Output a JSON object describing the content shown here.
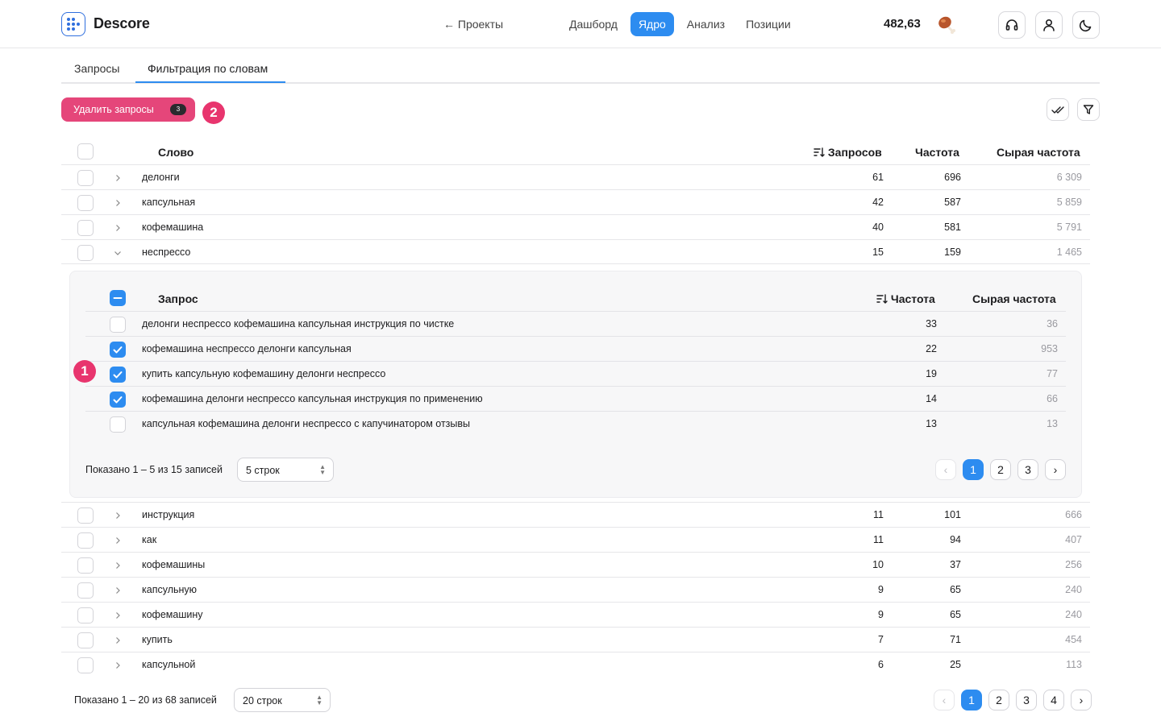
{
  "header": {
    "brand": "Descore",
    "projects_link": "← Проекты",
    "nav": [
      "Дашборд",
      "Ядро",
      "Анализ",
      "Позиции"
    ],
    "active_nav": "Ядро",
    "balance": "482,63"
  },
  "tabs": [
    "Запросы",
    "Фильтрация по словам"
  ],
  "active_tab": "Фильтрация по словам",
  "toolbar": {
    "delete_label": "Удалить запросы",
    "delete_count": "3",
    "marker_2": "2",
    "marker_1": "1"
  },
  "table": {
    "headers": {
      "word": "Слово",
      "queries": "Запросов",
      "freq": "Частота",
      "raw": "Сырая частота"
    },
    "rows_top": [
      {
        "word": "делонги",
        "queries": "61",
        "freq": "696",
        "raw": "6 309"
      },
      {
        "word": "капсульная",
        "queries": "42",
        "freq": "587",
        "raw": "5 859"
      },
      {
        "word": "кофемашина",
        "queries": "40",
        "freq": "581",
        "raw": "5 791"
      },
      {
        "word": "неспрессо",
        "queries": "15",
        "freq": "159",
        "raw": "1 465"
      }
    ],
    "rows_bottom": [
      {
        "word": "инструкция",
        "queries": "11",
        "freq": "101",
        "raw": "666"
      },
      {
        "word": "как",
        "queries": "11",
        "freq": "94",
        "raw": "407"
      },
      {
        "word": "кофемашины",
        "queries": "10",
        "freq": "37",
        "raw": "256"
      },
      {
        "word": "капсульную",
        "queries": "9",
        "freq": "65",
        "raw": "240"
      },
      {
        "word": "кофемашину",
        "queries": "9",
        "freq": "65",
        "raw": "240"
      },
      {
        "word": "купить",
        "queries": "7",
        "freq": "71",
        "raw": "454"
      },
      {
        "word": "капсульной",
        "queries": "6",
        "freq": "25",
        "raw": "113"
      }
    ],
    "footer": {
      "shown": "Показано 1 – 20 из 68 записей",
      "rows_select": "20 строк",
      "pages": [
        "1",
        "2",
        "3",
        "4"
      ]
    }
  },
  "subtable": {
    "headers": {
      "query": "Запрос",
      "freq": "Частота",
      "raw": "Сырая частота"
    },
    "rows": [
      {
        "query": "делонги неспрессо кофемашина капсульная инструкция по чистке",
        "freq": "33",
        "raw": "36",
        "checked": false
      },
      {
        "query": "кофемашина неспрессо делонги капсульная",
        "freq": "22",
        "raw": "953",
        "checked": true
      },
      {
        "query": "купить капсульную кофемашину делонги неспрессо",
        "freq": "19",
        "raw": "77",
        "checked": true
      },
      {
        "query": "кофемашина делонги неспрессо капсульная инструкция по применению",
        "freq": "14",
        "raw": "66",
        "checked": true
      },
      {
        "query": "капсульная кофемашина делонги неспрессо с капучинатором отзывы",
        "freq": "13",
        "raw": "13",
        "checked": false
      }
    ],
    "footer": {
      "shown": "Показано 1 – 5 из 15 записей",
      "rows_select": "5 строк",
      "pages": [
        "1",
        "2",
        "3"
      ]
    }
  },
  "colors": {
    "accent": "#2d8cf0",
    "delete": "#e5467a",
    "marker": "#e8356e"
  }
}
